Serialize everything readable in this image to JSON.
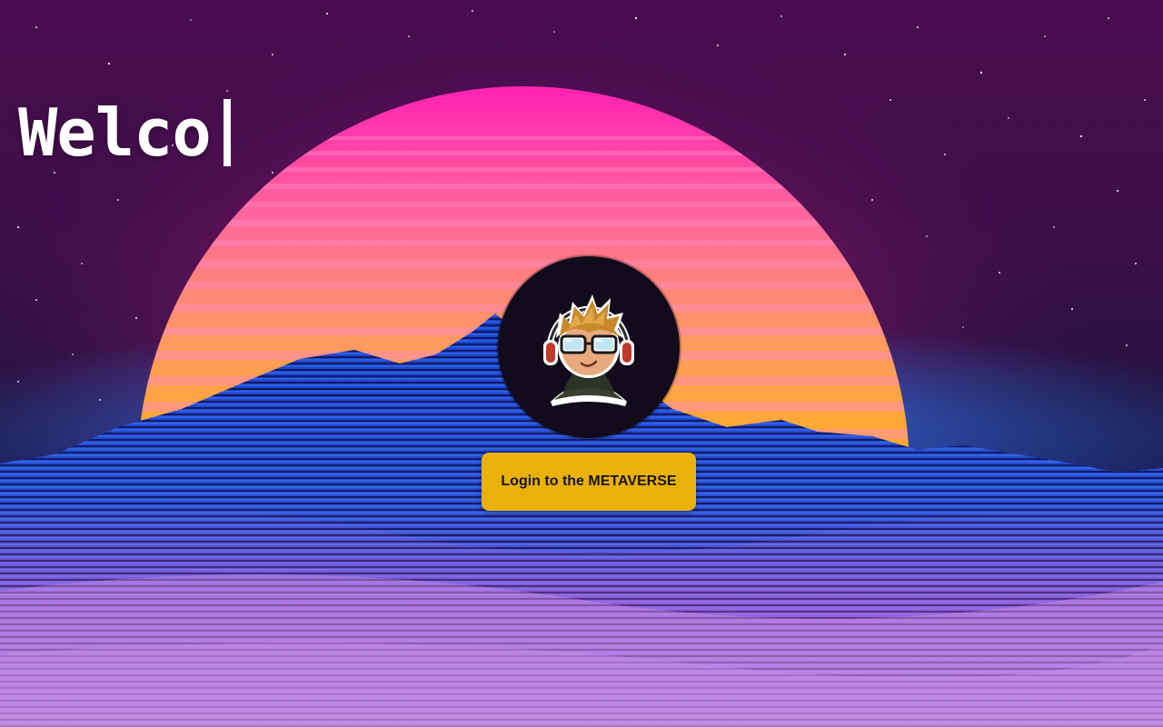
{
  "hero": {
    "typed_text": "Welco"
  },
  "login": {
    "button_label": "Login to the METAVERSE"
  },
  "theme": {
    "button_color": "#e9b10a",
    "sky_top": "#4a0c4e",
    "sun_top": "#ff1fb4",
    "sun_bottom": "#ffb21a",
    "grid_blue": "#2f7dff",
    "grid_pink": "#f07cf0"
  },
  "icons": {
    "avatar": "nerd-gamer-avatar-icon"
  }
}
